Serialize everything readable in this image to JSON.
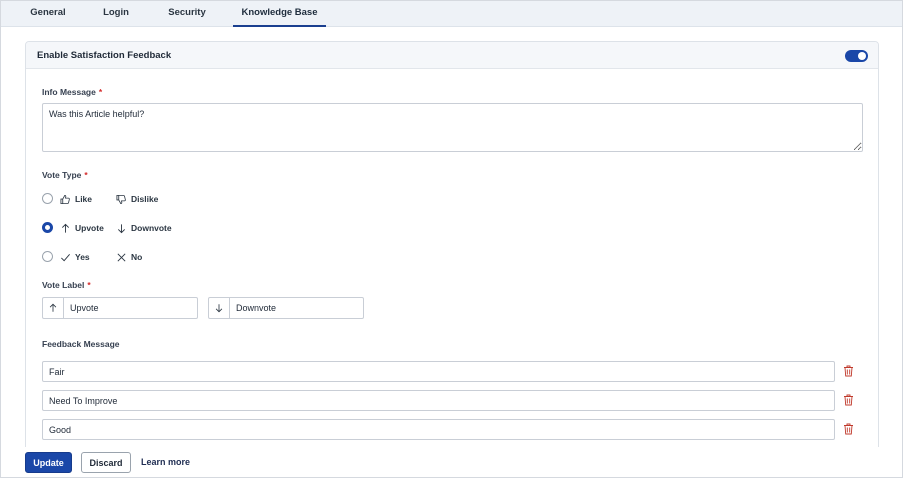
{
  "tabs": [
    {
      "label": "General"
    },
    {
      "label": "Login"
    },
    {
      "label": "Security"
    },
    {
      "label": "Knowledge Base"
    }
  ],
  "active_tab": "Knowledge Base",
  "panel": {
    "title": "Enable Satisfaction Feedback",
    "toggle_on": true
  },
  "info_message": {
    "label": "Info Message",
    "required_mark": "*",
    "value": "Was this Article helpful?"
  },
  "vote_type": {
    "label": "Vote Type",
    "required_mark": "*",
    "options": [
      {
        "positive": "Like",
        "positive_icon": "thumbs-up-icon",
        "negative": "Dislike",
        "negative_icon": "thumbs-down-icon",
        "selected": false
      },
      {
        "positive": "Upvote",
        "positive_icon": "arrow-up-icon",
        "negative": "Downvote",
        "negative_icon": "arrow-down-icon",
        "selected": true
      },
      {
        "positive": "Yes",
        "positive_icon": "check-icon",
        "negative": "No",
        "negative_icon": "x-icon",
        "selected": false
      }
    ]
  },
  "vote_label": {
    "label": "Vote Label",
    "required_mark": "*",
    "up_value": "Upvote",
    "down_value": "Downvote"
  },
  "feedback_message": {
    "label": "Feedback Message",
    "items": [
      "Fair",
      "Need To Improve",
      "Good"
    ]
  },
  "footer": {
    "update_label": "Update",
    "discard_label": "Discard",
    "learn_more_label": "Learn more"
  },
  "colors": {
    "accent": "#1a47a8",
    "required": "#d42b2b",
    "delete": "#c0392b"
  }
}
